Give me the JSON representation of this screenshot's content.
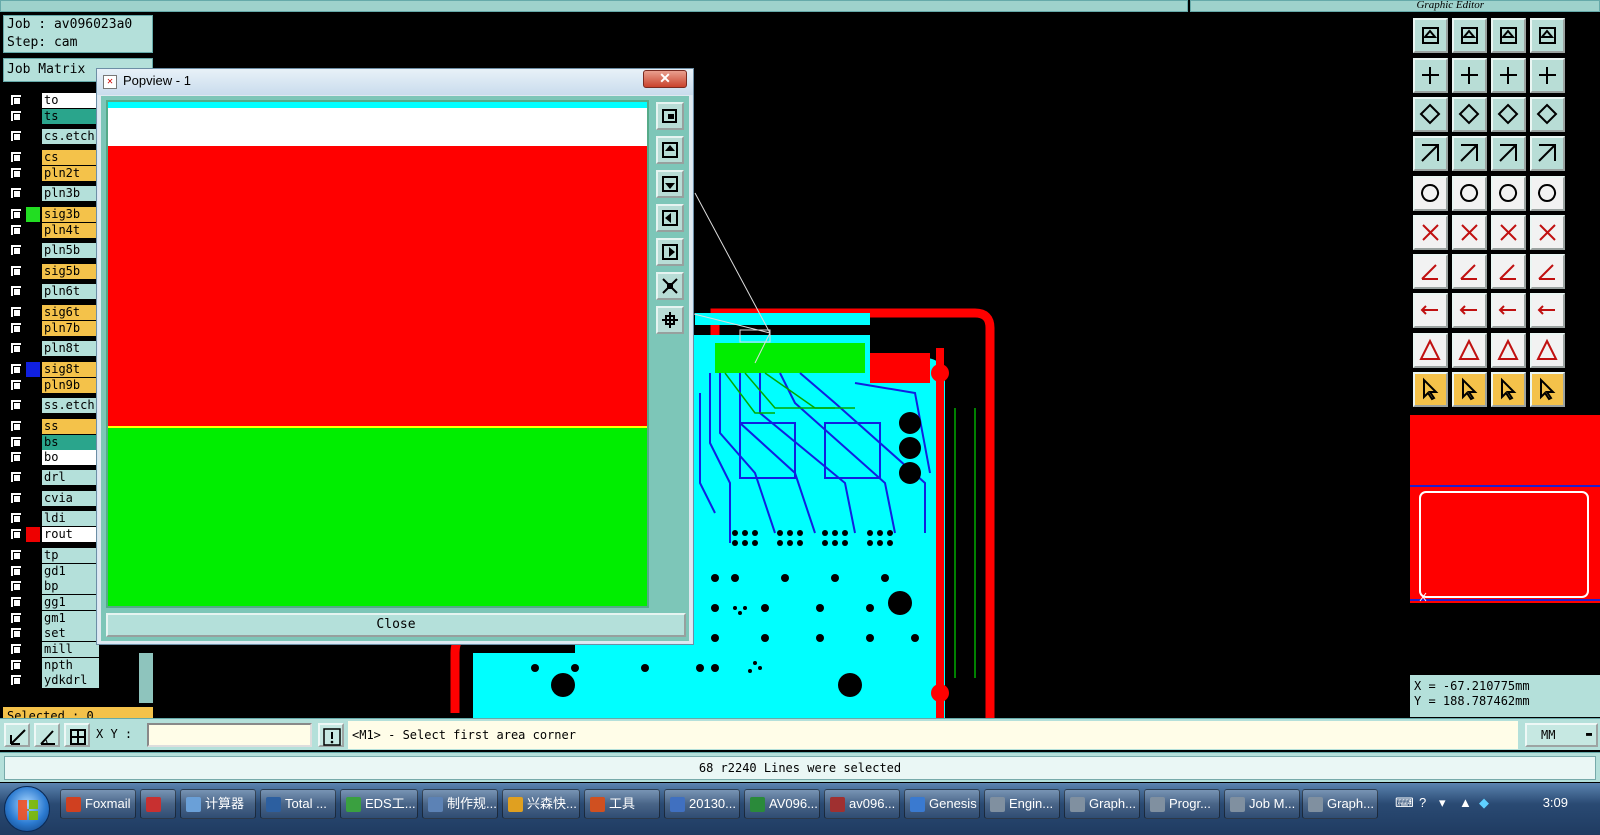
{
  "window": {
    "right_title": "Graphic Editor"
  },
  "job": {
    "job_line": "Job : av096023a0",
    "step_line": "Step: cam",
    "matrix_label": "Job Matrix",
    "selected_label": "Selected : 0"
  },
  "layers": [
    {
      "name": "to",
      "bg": "#ffffff",
      "swatch": "#000000"
    },
    {
      "name": "ts",
      "bg": "#2aa58c",
      "swatch": "#000000"
    },
    {
      "name": "cs.etch",
      "bg": "#b4e0da",
      "swatch": "#000000"
    },
    {
      "name": "cs",
      "bg": "#f4c24a",
      "swatch": "#000000"
    },
    {
      "name": "pln2t",
      "bg": "#f4c24a",
      "swatch": "#000000"
    },
    {
      "name": "pln3b",
      "bg": "#b4e0da",
      "swatch": "#000000"
    },
    {
      "name": "sig3b",
      "bg": "#f4c24a",
      "swatch": "#22dd22"
    },
    {
      "name": "pln4t",
      "bg": "#f4c24a",
      "swatch": "#000000"
    },
    {
      "name": "pln5b",
      "bg": "#b4e0da",
      "swatch": "#000000"
    },
    {
      "name": "sig5b",
      "bg": "#f4c24a",
      "swatch": "#000000"
    },
    {
      "name": "pln6t",
      "bg": "#b4e0da",
      "swatch": "#000000"
    },
    {
      "name": "sig6t",
      "bg": "#f4c24a",
      "swatch": "#000000"
    },
    {
      "name": "pln7b",
      "bg": "#f4c24a",
      "swatch": "#000000"
    },
    {
      "name": "pln8t",
      "bg": "#b4e0da",
      "swatch": "#000000"
    },
    {
      "name": "sig8t",
      "bg": "#f4c24a",
      "swatch": "#1020e0"
    },
    {
      "name": "pln9b",
      "bg": "#f4c24a",
      "swatch": "#000000"
    },
    {
      "name": "ss.etch",
      "bg": "#b4e0da",
      "swatch": "#000000"
    },
    {
      "name": "ss",
      "bg": "#f4c24a",
      "swatch": "#000000"
    },
    {
      "name": "bs",
      "bg": "#2aa58c",
      "swatch": "#000000"
    },
    {
      "name": "bo",
      "bg": "#ffffff",
      "swatch": "#000000"
    },
    {
      "name": "drl",
      "bg": "#b4e0da",
      "swatch": "#000000"
    },
    {
      "name": "cvia",
      "bg": "#b4e0da",
      "swatch": "#000000"
    },
    {
      "name": "ldi",
      "bg": "#b4e0da",
      "swatch": "#000000"
    },
    {
      "name": "rout",
      "bg": "#ffffff",
      "swatch": "#ee0000"
    },
    {
      "name": "tp",
      "bg": "#b4e0da",
      "swatch": "#000000"
    },
    {
      "name": "gd1",
      "bg": "#b4e0da",
      "swatch": "#000000"
    },
    {
      "name": "bp",
      "bg": "#b4e0da",
      "swatch": "#000000"
    },
    {
      "name": "gg1",
      "bg": "#b4e0da",
      "swatch": "#000000"
    },
    {
      "name": "gm1",
      "bg": "#b4e0da",
      "swatch": "#000000"
    },
    {
      "name": "set",
      "bg": "#b4e0da",
      "swatch": "#000000"
    },
    {
      "name": "mill",
      "bg": "#b4e0da",
      "swatch": "#000000"
    },
    {
      "name": "npth",
      "bg": "#b4e0da",
      "swatch": "#000000"
    },
    {
      "name": "ydkdrl",
      "bg": "#b4e0da",
      "swatch": "#000000"
    }
  ],
  "popup": {
    "title": "Popview - 1",
    "close_label": "Close"
  },
  "command": {
    "xy_label": "X Y :",
    "xy_value": "",
    "prompt": "<M1> - Select first area corner",
    "units": "MM"
  },
  "status": {
    "message": "68 r2240 Lines were selected"
  },
  "coords": {
    "x": "X = -67.210775mm",
    "y": "Y = 188.787462mm"
  },
  "taskbar": {
    "items": [
      "Foxmail",
      "",
      "计算器",
      "Total ...",
      "EDS工...",
      "制作规...",
      "兴森快...",
      "工具",
      "20130...",
      "AV096...",
      "av096...",
      "Genesis",
      "Engin...",
      "Graph...",
      "Progr...",
      "Job M...",
      "Graph..."
    ],
    "clock": "3:09"
  },
  "colors": {
    "panel": "#b4e0da",
    "accent": "#f4c24a",
    "board": "#00ffff",
    "outline": "#ff0000",
    "copper": "#00ee00"
  }
}
